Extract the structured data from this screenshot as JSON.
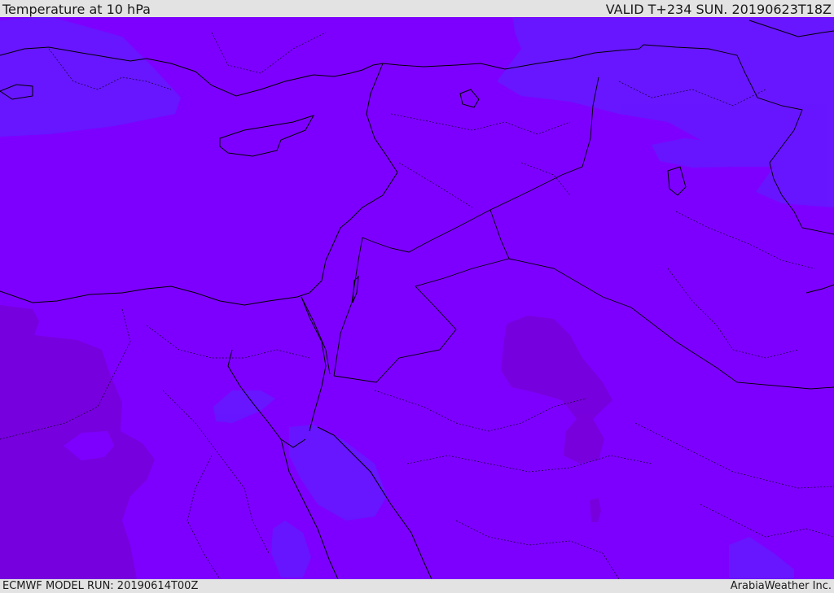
{
  "header": {
    "title": "Temperature at 10 hPa",
    "valid": "VALID T+234 SUN. 20190623T18Z"
  },
  "footer": {
    "model_run": "ECMWF MODEL RUN: 20190614T00Z",
    "credit": "ArabiaWeather Inc."
  },
  "map": {
    "field": "temperature",
    "level": "10 hPa",
    "colors": {
      "base_field": "#7d00ff",
      "warmer_patches": "#7700dc",
      "cooler_patches": "#6518ff",
      "coastline": "#000000",
      "borders": "#000000"
    }
  }
}
